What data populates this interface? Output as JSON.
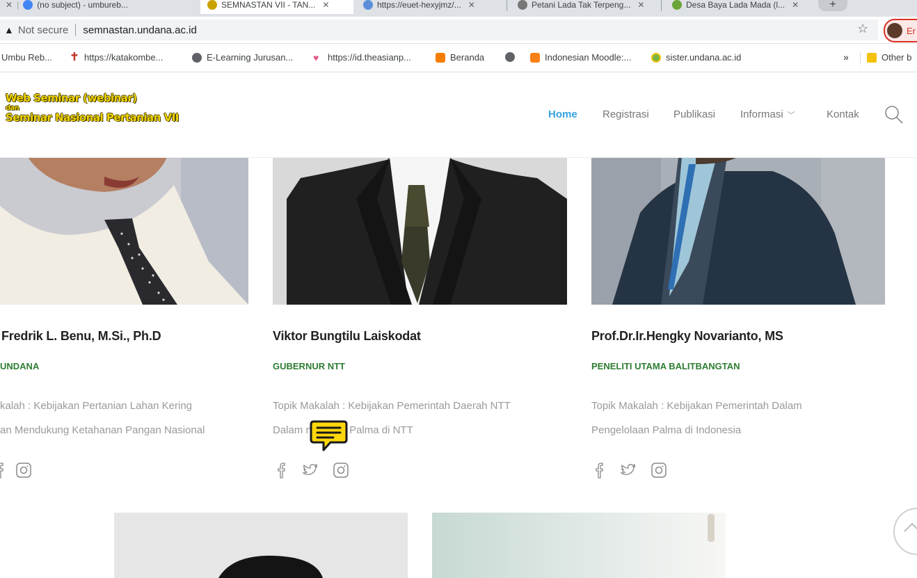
{
  "browser": {
    "tabs": [
      {
        "label": "(no subject) - umbureb..."
      },
      {
        "label": "SEMNASTAN VII - TAN..."
      },
      {
        "label": "https://euet-hexyjmz/..."
      },
      {
        "label": "Petani Lada Tak Terpeng..."
      },
      {
        "label": "Desa Baya Lada Mada (l..."
      }
    ],
    "new_tab_symbol": "+",
    "address": {
      "warning_symbol": "▲",
      "security_label": "Not secure",
      "url": "semnastan.undana.ac.id"
    },
    "star_symbol": "☆",
    "profile_label": "Er",
    "bookmarks": [
      {
        "label": "Umbu Reb...",
        "icon": "envelope-icon"
      },
      {
        "label": "https://katakombe...",
        "icon": "cross-icon"
      },
      {
        "label": "E-Learning Jurusan...",
        "icon": "globe-icon"
      },
      {
        "label": "https://id.theasianp...",
        "icon": "heart-icon"
      },
      {
        "label": "Beranda",
        "icon": "blogger-icon"
      },
      {
        "label": "",
        "icon": "globe-icon"
      },
      {
        "label": "Indonesian Moodle:...",
        "icon": "moodle-icon"
      },
      {
        "label": "sister.undana.ac.id",
        "icon": "undana-icon"
      }
    ],
    "bookmarks_more": "»",
    "other_bookmarks": "Other b"
  },
  "site": {
    "logo": {
      "line1": "Web Seminar (webinar)",
      "line2": "dan",
      "line3": "Seminar Nasional Pertanian VII"
    },
    "nav": {
      "home": "Home",
      "registrasi": "Registrasi",
      "publikasi": "Publikasi",
      "informasi": "Informasi",
      "kontak": "Kontak",
      "dropdown_symbol": "﹀"
    }
  },
  "speakers": [
    {
      "name": "Fredrik L. Benu, M.Si., Ph.D",
      "role": "UNDANA",
      "topic_line1": "kalah : Kebijakan Pertanian Lahan Kering",
      "topic_line2": "an Mendukung Ketahanan Pangan Nasional"
    },
    {
      "name": "Viktor Bungtilu Laiskodat",
      "role": "GUBERNUR NTT",
      "topic_line1": "Topik Makalah : Kebijakan Pemerintah Daerah  NTT",
      "topic_line2": "Dalam           nbangan Palma di NTT"
    },
    {
      "name": "Prof.Dr.Ir.Hengky Novarianto, MS",
      "role": "PENELITI UTAMA BALITBANGTAN",
      "topic_line1": "Topik Makalah : Kebijakan Pemerintah Dalam",
      "topic_line2": "Pengelolaan Palma di Indonesia"
    }
  ],
  "colors": {
    "nav_active": "#35a3df",
    "role_green": "#2e7d32",
    "logo_yellow": "#f2d300",
    "chat_yellow": "#ffd60a"
  }
}
